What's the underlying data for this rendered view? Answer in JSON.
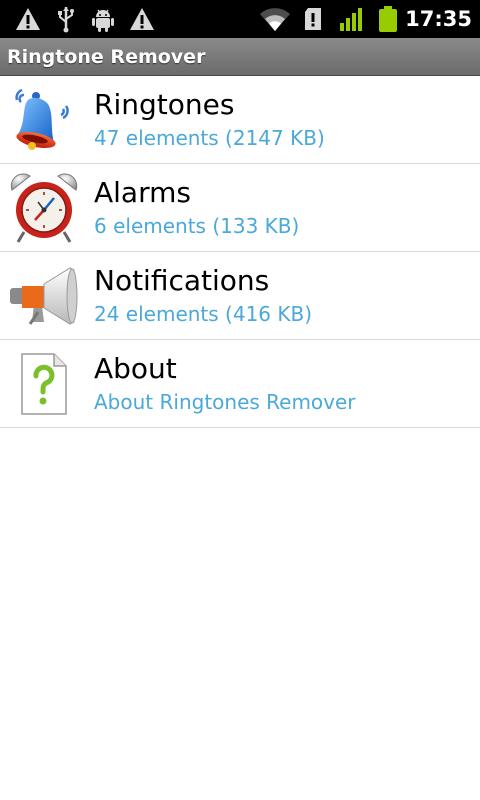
{
  "status_bar": {
    "time": "17:35",
    "left_icons": [
      "warning-icon",
      "usb-icon",
      "android-debug-icon",
      "warning-icon"
    ],
    "right_icons": [
      "wifi-icon",
      "sd-card-icon",
      "signal-icon",
      "battery-icon"
    ],
    "signal_color": "#99cc00",
    "battery_color": "#99cc00"
  },
  "app": {
    "title": "Ringtone Remover"
  },
  "list": {
    "items": [
      {
        "title": "Ringtones",
        "subtitle": "47 elements (2147 KB)",
        "icon": "bell-icon"
      },
      {
        "title": "Alarms",
        "subtitle": "6 elements (133 KB)",
        "icon": "alarm-clock-icon"
      },
      {
        "title": "Notifications",
        "subtitle": "24 elements (416 KB)",
        "icon": "megaphone-icon"
      },
      {
        "title": "About",
        "subtitle": "About Ringtones Remover",
        "icon": "help-document-icon"
      }
    ]
  },
  "colors": {
    "subtitle": "#4aa9d8",
    "divider": "#d9d9d9",
    "title_bar": "#7a7a7a"
  }
}
